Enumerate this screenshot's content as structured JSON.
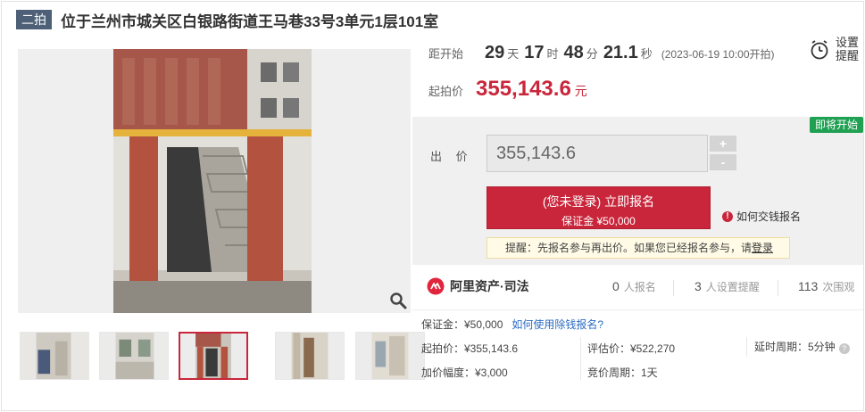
{
  "header": {
    "round": "二拍",
    "title": "位于兰州市城关区白银路街道王马巷33号3单元1层101室"
  },
  "countdown": {
    "label": "距开始",
    "days": "29",
    "days_unit": "天",
    "hours": "17",
    "hours_unit": "时",
    "minutes": "48",
    "minutes_unit": "分",
    "seconds": "21.1",
    "seconds_unit": "秒",
    "start_time": "(2023-06-19 10:00开拍)"
  },
  "remind": {
    "label": "设置提醒",
    "icon": "alarm-clock-icon"
  },
  "start_price": {
    "label": "起拍价",
    "value": "355,143.6",
    "unit": "元"
  },
  "bid": {
    "status_badge": "即将开始",
    "label": "出 价",
    "input_value": "355,143.6",
    "plus": "+",
    "minus": "-",
    "signup_main": "(您未登录) 立即报名",
    "signup_sub": "保证金 ¥50,000",
    "howto_icon": "!",
    "howto": "如何交钱报名",
    "notice_text": "提醒：先报名参与再出价。如果您已经报名参与，请",
    "notice_link": "登录"
  },
  "stats": {
    "logo_text": "阿里资产·司法",
    "signups": "0",
    "signups_label": "人报名",
    "reminders": "3",
    "reminders_label": "人设置提醒",
    "views": "113",
    "views_label": "次围观"
  },
  "details": {
    "deposit": "保证金：¥50,000",
    "deposit_link": "如何使用除钱报名?",
    "start_price": "起拍价：¥355,143.6",
    "appraisal": "评估价：¥522,270",
    "delay": "延时周期：5分钟",
    "increment": "加价幅度：¥3,000",
    "cycle": "竞价周期：1天",
    "help": "?"
  },
  "colors": {
    "accent": "#c9263b",
    "badge_green": "#1fa052",
    "link": "#2b6cc4",
    "round_badge": "#4d6077"
  }
}
